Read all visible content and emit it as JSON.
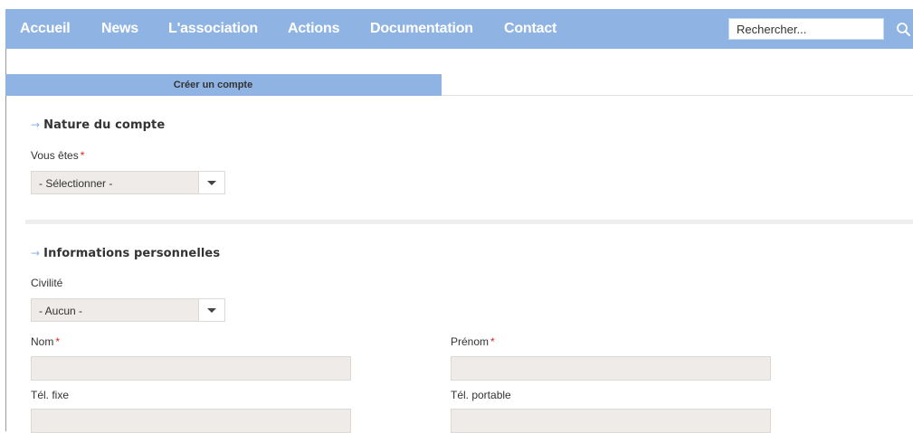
{
  "nav": {
    "items": [
      "Accueil",
      "News",
      "L'association",
      "Actions",
      "Documentation",
      "Contact"
    ],
    "search": {
      "placeholder": "Rechercher...",
      "icon": "search-icon"
    },
    "background_color": "#8fb4e3"
  },
  "tab": {
    "label": "Créer un compte"
  },
  "sections": {
    "nature": {
      "title": "Nature du compte",
      "field_label": "Vous êtes",
      "required_mark": "*",
      "select_value": "- Sélectionner -"
    },
    "personal": {
      "title": "Informations personnelles",
      "civility_label": "Civilité",
      "civility_value": "- Aucun -",
      "lastname_label": "Nom",
      "firstname_label": "Prénom",
      "required_mark": "*",
      "landline_label": "Tél. fixe",
      "mobile_label": "Tél. portable"
    }
  },
  "form_values": {
    "lastname": "",
    "firstname": "",
    "landline": "",
    "mobile": ""
  },
  "colors": {
    "accent": "#8fb4e3",
    "required": "#e02020",
    "field_bg": "#eeebe8"
  }
}
